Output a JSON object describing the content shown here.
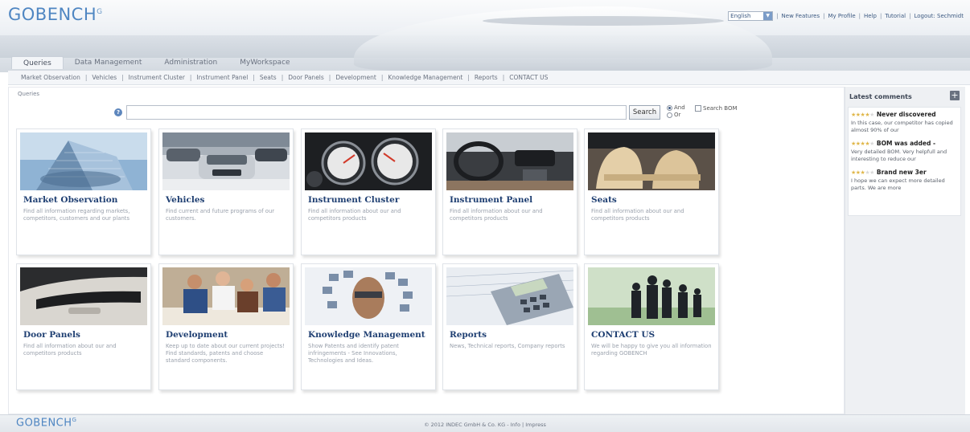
{
  "app": {
    "logo_text": "GOBENCH",
    "logo_sup": "G"
  },
  "topbar": {
    "language_value": "English",
    "links": [
      "New Features",
      "My Profile",
      "Help",
      "Tutorial",
      "Logout: Sechmidt"
    ]
  },
  "tabs": [
    "Queries",
    "Data Management",
    "Administration",
    "MyWorkspace"
  ],
  "active_tab": "Queries",
  "subnav": [
    "Market Observation",
    "Vehicles",
    "Instrument Cluster",
    "Instrument Panel",
    "Seats",
    "Door Panels",
    "Development",
    "Knowledge Management",
    "Reports",
    "CONTACT US"
  ],
  "breadcrumb": "Queries",
  "search": {
    "value": "",
    "button_label": "Search",
    "radio_and": "And",
    "radio_or": "Or",
    "bom_label": "Search BOM"
  },
  "cards": [
    {
      "title": "Market Observation",
      "desc": "Find all information regarding markets, competitors, customers and our plants",
      "image": "office-building"
    },
    {
      "title": "Vehicles",
      "desc": "Find current and future programs of our customers.",
      "image": "cars"
    },
    {
      "title": "Instrument Cluster",
      "desc": "Find all information about our and competitors products",
      "image": "gauges"
    },
    {
      "title": "Instrument Panel",
      "desc": "Find all information about our and competitors products",
      "image": "dashboard"
    },
    {
      "title": "Seats",
      "desc": "Find all information about our and competitors products",
      "image": "car-seats"
    },
    {
      "title": "Door Panels",
      "desc": "Find all information about our and competitors products",
      "image": "door-panel"
    },
    {
      "title": "Development",
      "desc": "Keep up to date about our current projects! Find standards, patents and choose standard components.",
      "image": "meeting"
    },
    {
      "title": "Knowledge Management",
      "desc": "Show Patents and identify patent infringements - See Innovations, Technologies and Ideas.",
      "image": "face-screens"
    },
    {
      "title": "Reports",
      "desc": "News, Technical reports, Company reports",
      "image": "calculator"
    },
    {
      "title": "CONTACT US",
      "desc": "We will be happy to give you all information regarding GOBENCH",
      "image": "business-people"
    }
  ],
  "sidebar": {
    "title": "Latest comments",
    "comments": [
      {
        "stars": 4,
        "title": "Never discovered",
        "text": "In this case, our competitor has copied almost 90% of our"
      },
      {
        "stars": 4,
        "title": "BOM was added - ",
        "text": "Very detailed BOM. Very helpfull and interesting to reduce our"
      },
      {
        "stars": 3,
        "title": "Brand new 3er",
        "text": "I hope we can expect more detailed parts. We are more"
      }
    ]
  },
  "footer": {
    "logo_text": "GOBENCH",
    "logo_sup": "G",
    "copyright": "© 2012 INDEC GmbH & Co. KG - Info | Impress"
  }
}
